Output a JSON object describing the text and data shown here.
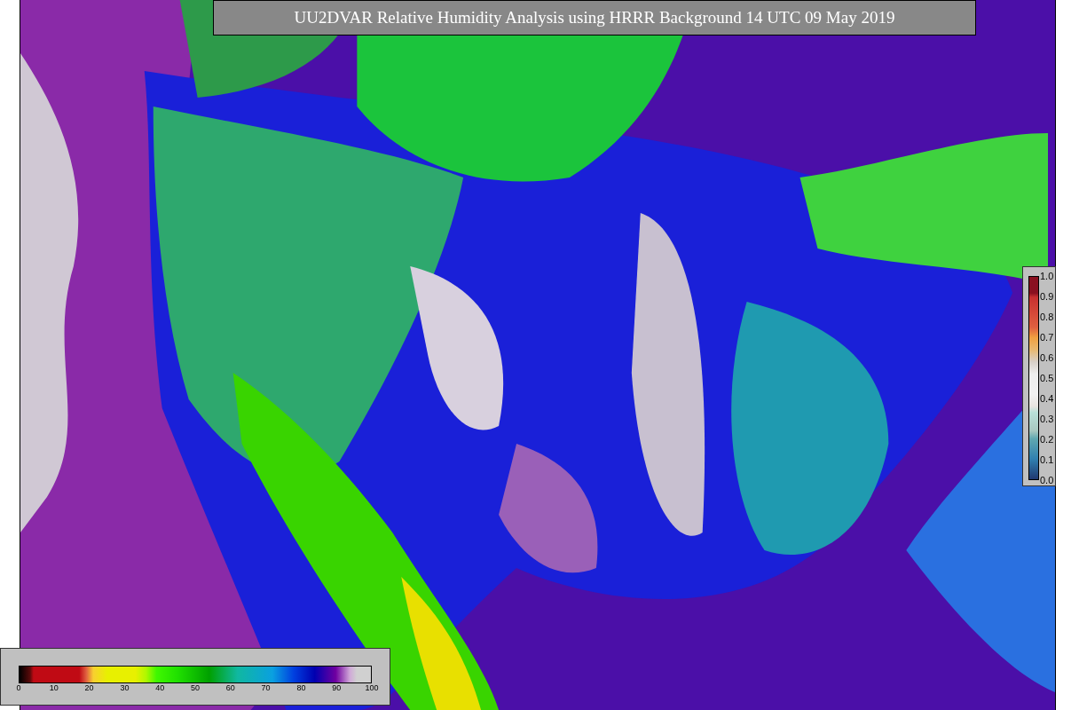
{
  "title": "UU2DVAR Relative Humidity Analysis using HRRR Background 14 UTC 09 May 2019",
  "humidity_colorbar": {
    "ticks": [
      "0",
      "10",
      "20",
      "30",
      "40",
      "50",
      "60",
      "70",
      "80",
      "90",
      "100"
    ]
  },
  "observation_colorbar": {
    "ticks": [
      "1.0",
      "0.9",
      "0.8",
      "0.7",
      "0.6",
      "0.5",
      "0.4",
      "0.3",
      "0.2",
      "0.1",
      "0.0"
    ]
  }
}
